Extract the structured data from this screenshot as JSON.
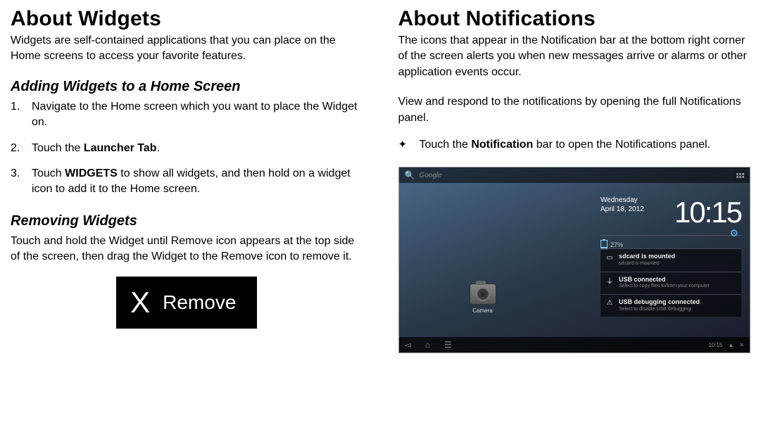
{
  "left": {
    "heading": "About Widgets",
    "intro": "Widgets are self-contained applications that you can place on the Home screens to access your favorite features.",
    "sec1_heading": "Adding Widgets to a Home Screen",
    "steps": {
      "s1": "Navigate to the Home screen which you want to place the Widget on.",
      "s2a": "Touch the ",
      "s2b": "Launcher Tab",
      "s2c": ".",
      "s3a": "Touch ",
      "s3b": "WIDGETS",
      "s3c": " to show all widgets, and then hold on a widget icon to add it to the Home screen."
    },
    "sec2_heading": "Removing Widgets",
    "remove_para": "Touch and hold the Widget until Remove icon appears at the top side of the screen, then drag the Widget to the Remove icon to remove it.",
    "remove_btn_x": "X",
    "remove_btn_label": "Remove"
  },
  "right": {
    "heading": "About Notifications",
    "intro": "The icons that appear in the Notification bar at the bottom right corner of the screen alerts you when new messages arrive or alarms or other application events occur.",
    "para2": "View and respond to the notifications by opening the full Notifications panel.",
    "bullet_a": "Touch the ",
    "bullet_b": "Notification",
    "bullet_c": " bar to open the Notifications panel."
  },
  "tablet": {
    "search_label": "Google",
    "camera_label": "Camera",
    "day": "Wednesday",
    "date": "April 18, 2012",
    "time": "10:15",
    "battery": "27%",
    "notifs": {
      "n1_title": "sdcard is mounted",
      "n1_sub": "sdcard is mounted",
      "n2_title": "USB connected",
      "n2_sub": "Select to copy files to/from your computer",
      "n3_title": "USB debugging connected",
      "n3_sub": "Select to disable USB debugging"
    },
    "status_time": "10:15"
  }
}
